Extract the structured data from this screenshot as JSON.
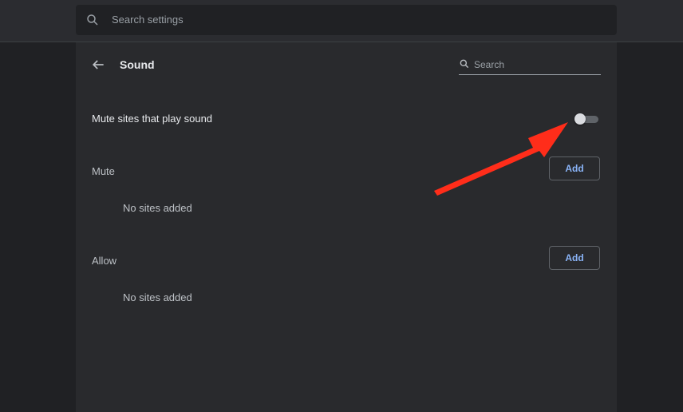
{
  "header": {
    "search_placeholder": "Search settings"
  },
  "page": {
    "title": "Sound",
    "search_placeholder": "Search"
  },
  "settings": {
    "mute_toggle_label": "Mute sites that play sound",
    "mute_toggle_on": false
  },
  "mute_section": {
    "label": "Mute",
    "add_label": "Add",
    "empty_text": "No sites added"
  },
  "allow_section": {
    "label": "Allow",
    "add_label": "Add",
    "empty_text": "No sites added"
  },
  "icons": {
    "search": "search-icon",
    "back": "back-arrow-icon",
    "annotation": "red-pointer-arrow"
  },
  "colors": {
    "background": "#202124",
    "panel": "#292a2d",
    "accent": "#8ab4f8",
    "annotation": "#ff2d1a"
  }
}
